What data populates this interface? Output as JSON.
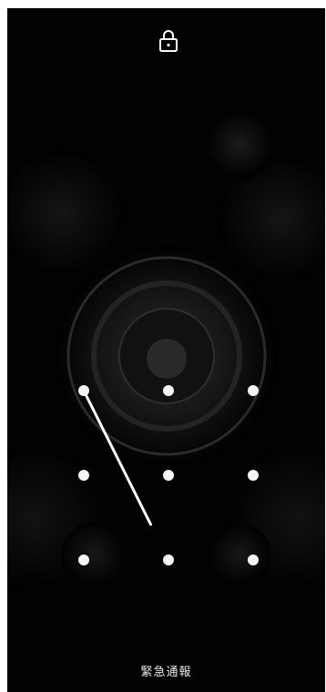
{
  "lock_icon": "lock-icon",
  "pattern": {
    "rows": 3,
    "cols": 3,
    "drawn_path": [
      1,
      8
    ],
    "dot_color": "#f4f4f4",
    "line_color": "#ffffff"
  },
  "emergency_call": {
    "label": "緊急通報"
  }
}
